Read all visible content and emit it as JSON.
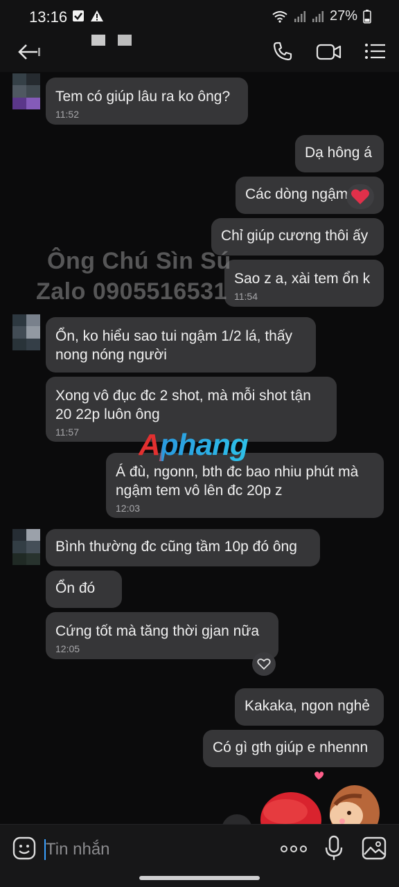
{
  "status_bar": {
    "time": "13:16",
    "battery": "27%"
  },
  "header": {
    "back_icon": "back-arrow-icon",
    "call_icon": "phone-icon",
    "video_icon": "video-camera-icon",
    "menu_icon": "list-menu-icon"
  },
  "watermark": {
    "line1": "Ông Chú Sìn Sú",
    "line2": "Zalo 0905516531",
    "logo": "Aphang"
  },
  "messages": [
    {
      "text": "Tem có giúp lâu ra ko ông?",
      "time": "11:52"
    },
    {
      "text": "Dạ hông á"
    },
    {
      "text": "Các dòng ngậm"
    },
    {
      "text": "Chỉ giúp cương thôi ấy"
    },
    {
      "text": "Sao z a, xài tem ổn k",
      "time": "11:54"
    },
    {
      "text": "Ổn, ko hiểu sao tui ngậm 1/2 lá, thấy nong nóng người"
    },
    {
      "text": "Xong vô đục đc 2 shot, mà mỗi shot tận 20 22p luôn ông",
      "time": "11:57"
    },
    {
      "text": "Á đù, ngonn, bth đc bao nhiu phút mà ngậm tem vô lên đc 20p z",
      "time": "12:03"
    },
    {
      "text": "Bình thường đc cũng tầm 10p đó ông"
    },
    {
      "text": "Ổn đó"
    },
    {
      "text": "Cứng tốt mà tăng thời gjan nữa",
      "time": "12:05"
    },
    {
      "text": "Kakaka, ngon nghẻ"
    },
    {
      "text": "Có gì gth giúp e nhennn"
    }
  ],
  "input": {
    "placeholder": "Tin nhắn"
  },
  "colors": {
    "bubble": "#363638",
    "background": "#0b0b0c",
    "cursor": "#3aa0ff",
    "heart": "#e0304a"
  }
}
